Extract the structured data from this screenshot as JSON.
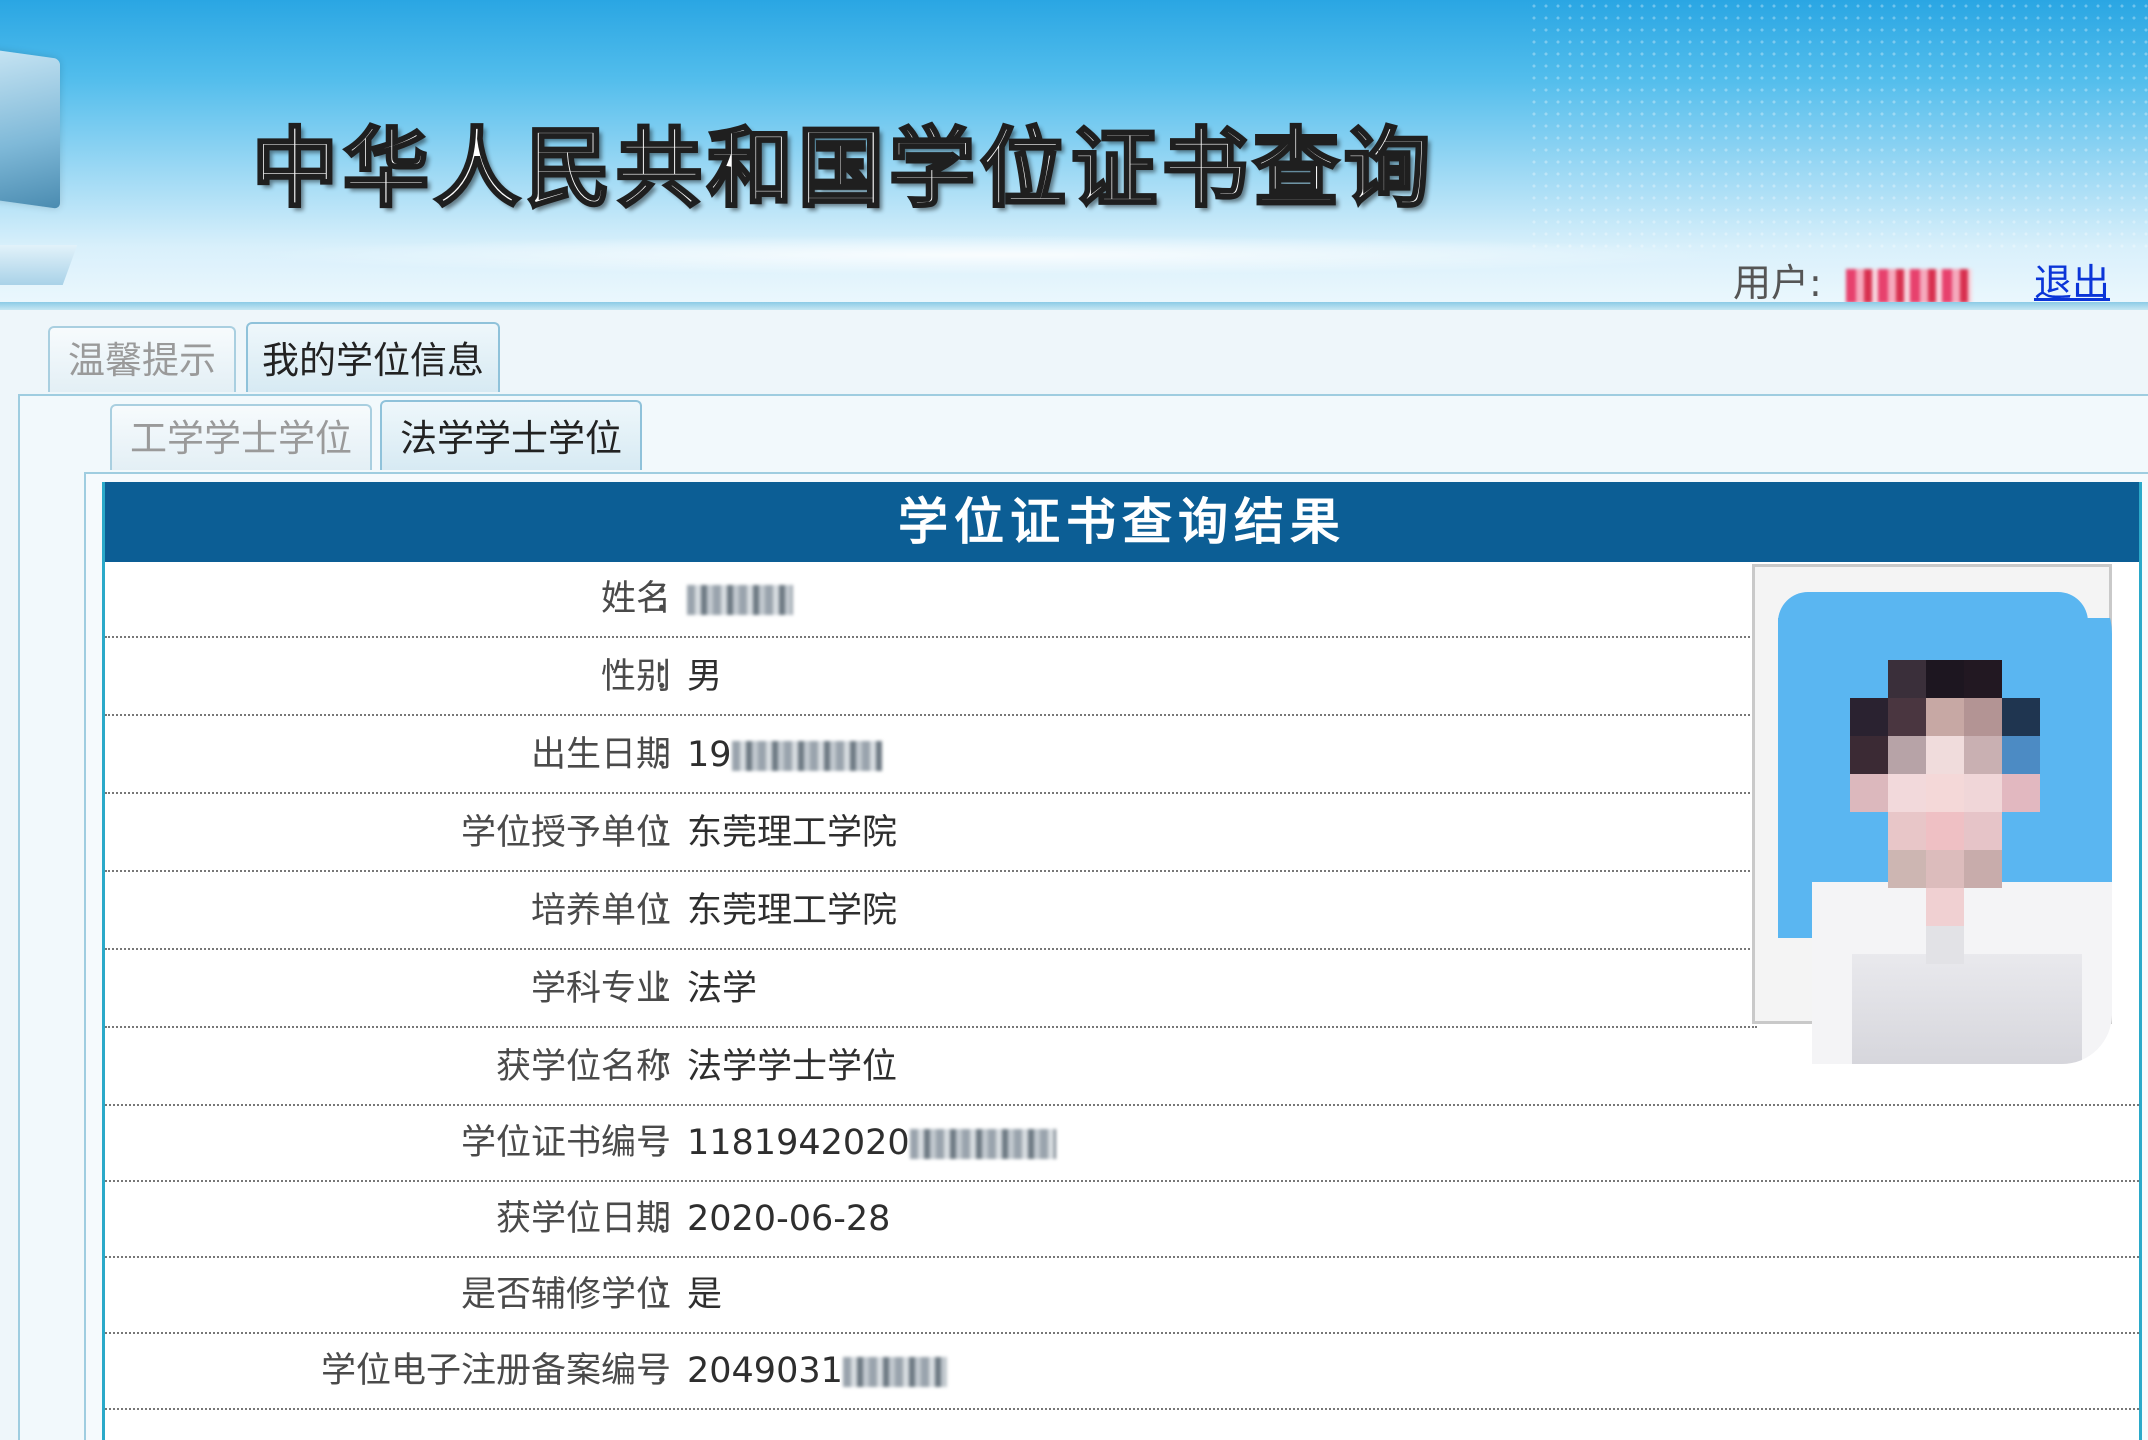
{
  "banner": {
    "title": "中华人民共和国学位证书查询",
    "user_label": "用户:",
    "logout_label": "退出"
  },
  "outer_tabs": [
    {
      "label": "温馨提示",
      "active": false
    },
    {
      "label": "我的学位信息",
      "active": true
    }
  ],
  "inner_tabs": [
    {
      "label": "工学学士学位",
      "active": false
    },
    {
      "label": "法学学士学位",
      "active": true
    }
  ],
  "result": {
    "title": "学位证书查询结果",
    "rows": [
      {
        "label": "姓名",
        "value": ""
      },
      {
        "label": "性别",
        "value": "男"
      },
      {
        "label": "出生日期",
        "value": "19"
      },
      {
        "label": "学位授予单位",
        "value": "东莞理工学院"
      },
      {
        "label": "培养单位",
        "value": "东莞理工学院"
      },
      {
        "label": "学科专业",
        "value": "法学"
      },
      {
        "label": "获学位名称",
        "value": "法学学士学位"
      },
      {
        "label": "学位证书编号",
        "value": "1181942020"
      },
      {
        "label": "获学位日期",
        "value": "2020-06-28"
      },
      {
        "label": "是否辅修学位",
        "value": "是"
      },
      {
        "label": "学位电子注册备案编号",
        "value": "2049031"
      }
    ],
    "colon": "："
  },
  "colors": {
    "header_bg": "#0c5e95",
    "table_border": "#2aa9c9",
    "logout_link": "#0b35d8",
    "photo_bg": "#5ab6f1"
  }
}
